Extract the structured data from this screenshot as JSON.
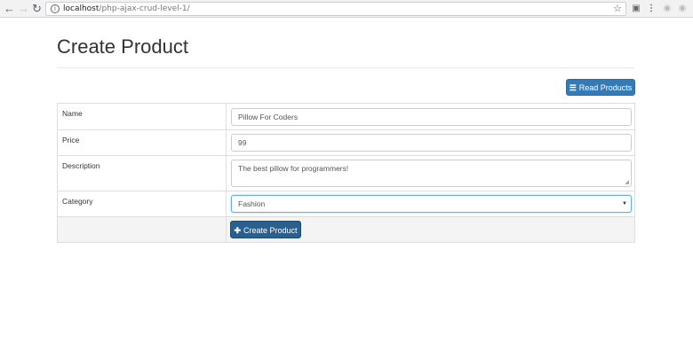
{
  "browser": {
    "url_host": "localhost",
    "url_path": "/php-ajax-crud-level-1/",
    "icons": [
      "back-icon",
      "forward-icon",
      "reload-icon",
      "info-icon",
      "star-icon",
      "camera-icon",
      "extension-icon",
      "extension-icon-2"
    ]
  },
  "page": {
    "title": "Create Product",
    "read_button_label": "Read Products",
    "create_button_label": "Create Product"
  },
  "form": {
    "name": {
      "label": "Name",
      "value": "Pillow For Coders"
    },
    "price": {
      "label": "Price",
      "value": "99"
    },
    "description": {
      "label": "Description",
      "value": "The best pillow for programmers!"
    },
    "category": {
      "label": "Category",
      "value": "Fashion"
    }
  },
  "colors": {
    "primary": "#337ab7",
    "primary_dark": "#286090",
    "border": "#dddddd",
    "focus": "#66afe9"
  }
}
